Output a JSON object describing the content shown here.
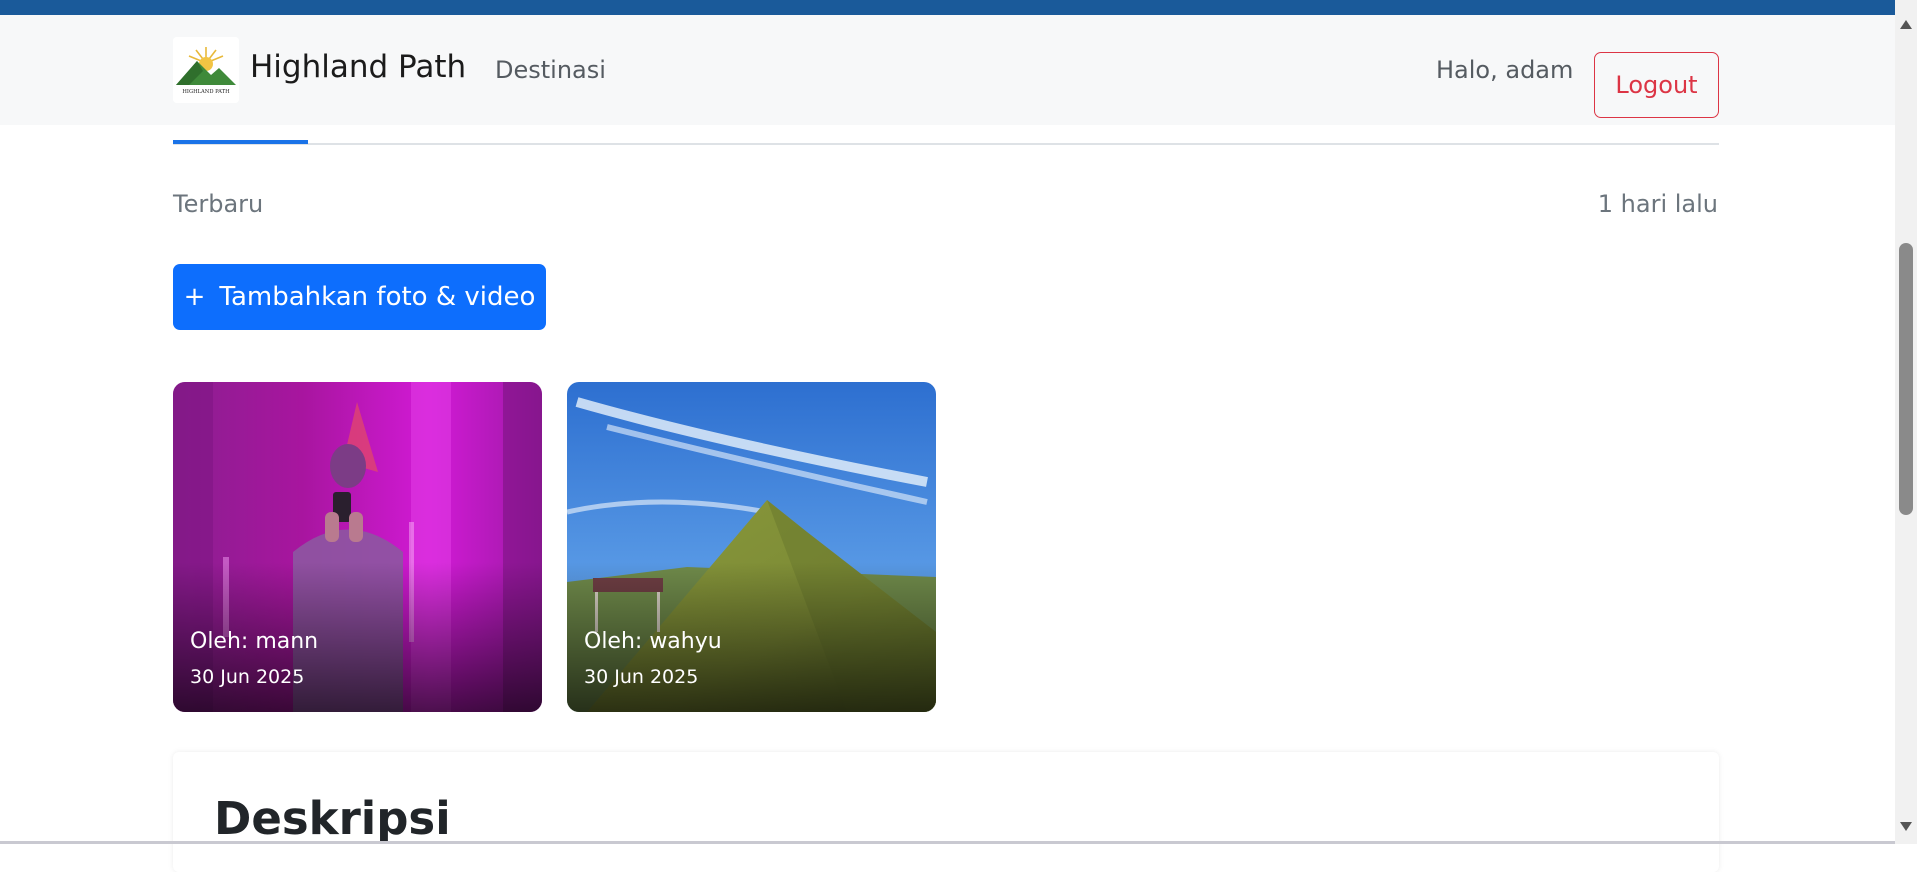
{
  "colors": {
    "topbar": "#1a5a9a",
    "navbar_bg": "#f7f8f9",
    "primary": "#0d6efd",
    "danger": "#dc3545",
    "tab_active": "#1a73e8"
  },
  "navbar": {
    "brand_name": "Highland Path",
    "logo_text": "HIGHLAND PATH",
    "links": [
      "Destinasi"
    ],
    "greeting": "Halo, adam",
    "logout_label": "Logout"
  },
  "gallery": {
    "sort_label": "Terbaru",
    "time_label": "1 hari lalu",
    "add_button_icon": "plus-icon",
    "add_button_label": "Tambahkan foto & video",
    "cards": [
      {
        "author": "Oleh: mann",
        "date": "30 Jun 2025"
      },
      {
        "author": "Oleh: wahyu",
        "date": "30 Jun 2025"
      }
    ]
  },
  "description": {
    "title": "Deskripsi"
  }
}
